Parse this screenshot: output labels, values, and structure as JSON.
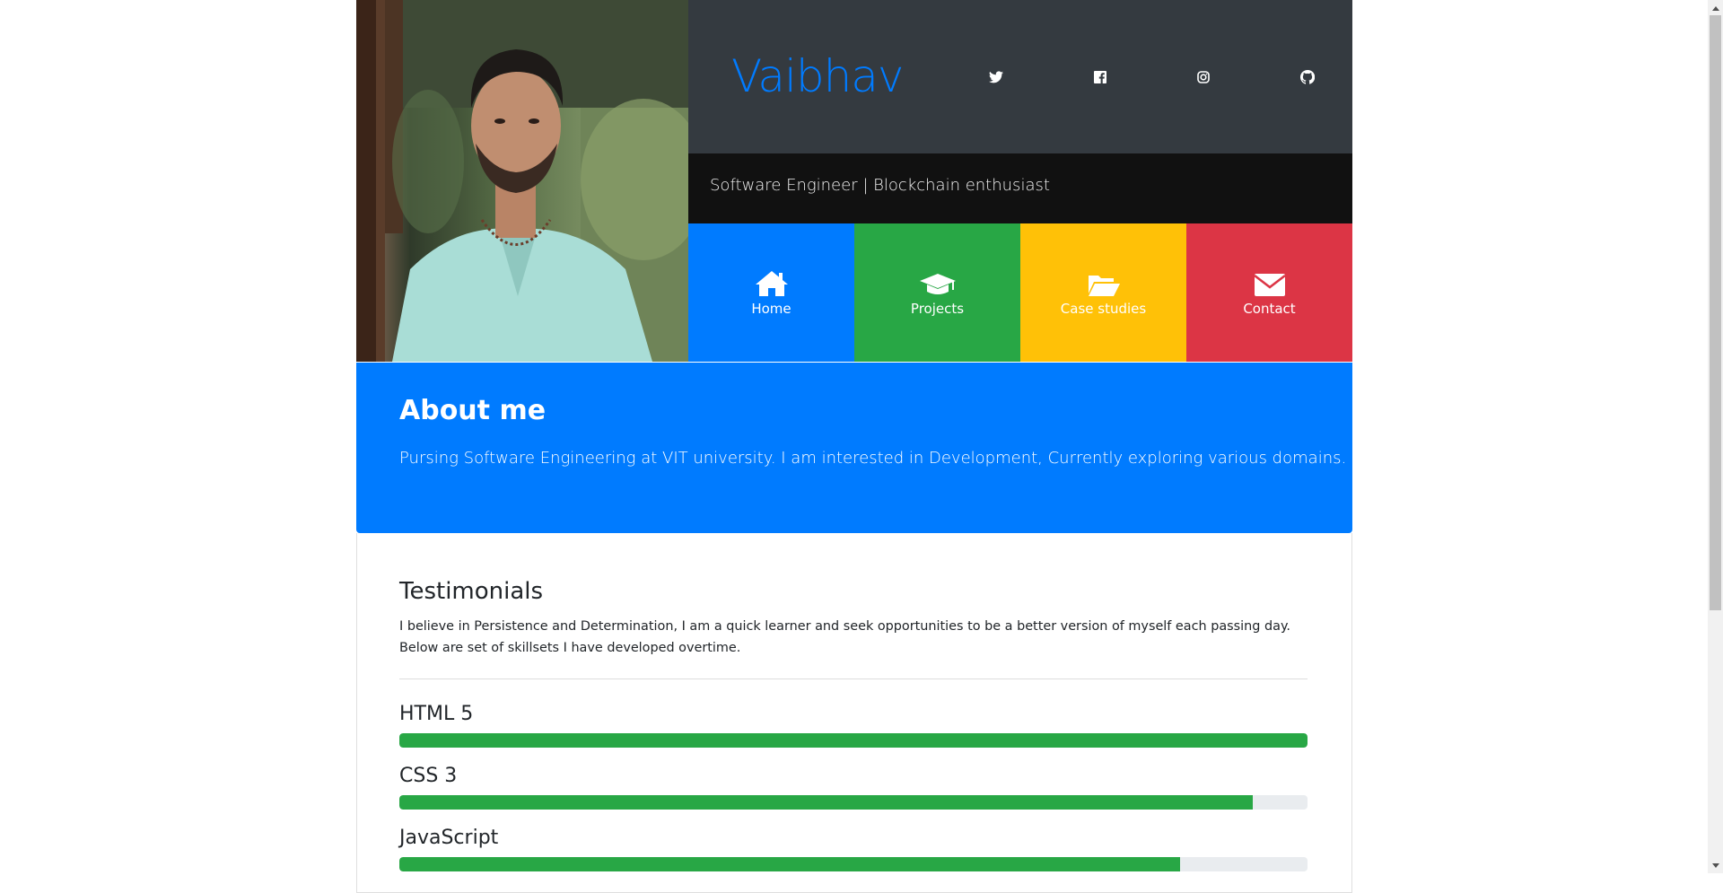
{
  "header": {
    "name": "Vaibhav",
    "tagline": "Software Engineer | Blockchain enthusiast",
    "photo_alt": "profile-photo"
  },
  "social": [
    {
      "icon": "twitter-icon"
    },
    {
      "icon": "facebook-icon"
    },
    {
      "icon": "instagram-icon"
    },
    {
      "icon": "github-icon"
    }
  ],
  "nav": [
    {
      "label": "Home",
      "icon": "home-icon",
      "color": "#007bff"
    },
    {
      "label": "Projects",
      "icon": "graduation-cap-icon",
      "color": "#28a745"
    },
    {
      "label": "Case studies",
      "icon": "folder-open-icon",
      "color": "#ffc107"
    },
    {
      "label": "Contact",
      "icon": "envelope-icon",
      "color": "#dc3545"
    }
  ],
  "about": {
    "title": "About me",
    "text": "Pursing Software Engineering at VIT university. I am interested in Development, Currently exploring various domains."
  },
  "testimonials": {
    "title": "Testimonials",
    "line1": "I believe in Persistence and Determination, I am a quick learner and seek opportunities to be a better version of myself each passing day.",
    "line2": "Below are set of skillsets I have developed overtime."
  },
  "skills": [
    {
      "name": "HTML 5",
      "level": 100
    },
    {
      "name": "CSS 3",
      "level": 94
    },
    {
      "name": "JavaScript",
      "level": 86
    }
  ],
  "colors": {
    "primary": "#007bff",
    "success": "#28a745",
    "warning": "#ffc107",
    "danger": "#dc3545",
    "dark": "#343a40"
  }
}
